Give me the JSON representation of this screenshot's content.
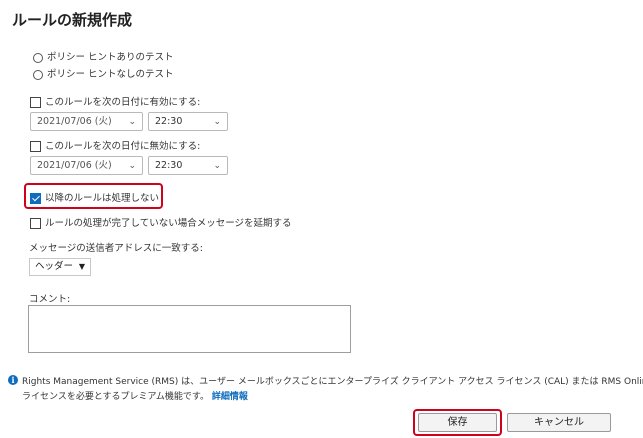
{
  "page": {
    "title": "ルールの新規作成"
  },
  "mode": {
    "option_hint_test": "ポリシー ヒントありのテスト",
    "option_nohint_test": "ポリシー ヒントなしのテスト"
  },
  "activate": {
    "label": "このルールを次の日付に有効にする:",
    "date": "2021/07/06 (火)",
    "time": "22:30",
    "checked": false
  },
  "deactivate": {
    "label": "このルールを次の日付に無効にする:",
    "date": "2021/07/06 (火)",
    "time": "22:30",
    "checked": false
  },
  "stop_processing": {
    "label": "以降のルールは処理しない",
    "checked": true
  },
  "defer": {
    "label": "ルールの処理が完了していない場合メッセージを延期する",
    "checked": false
  },
  "sender_match": {
    "label": "メッセージの送信者アドレスに一致する:",
    "value": "ヘッダー"
  },
  "comment": {
    "label": "コメント:",
    "value": ""
  },
  "info": {
    "text_line1": "Rights Management Service (RMS) は、ユーザー メールボックスごとにエンタープライズ クライアント アクセス ライセンス (CAL) または RMS Online",
    "text_line2": "ライセンスを必要とするプレミアム機能です。",
    "link": "詳細情報"
  },
  "buttons": {
    "save": "保存",
    "cancel": "キャンセル"
  },
  "icons": {
    "info": "info-icon",
    "chevron": "chevron-down-icon"
  },
  "colors": {
    "accent": "#0f6cbd",
    "highlight": "#d0021b"
  }
}
